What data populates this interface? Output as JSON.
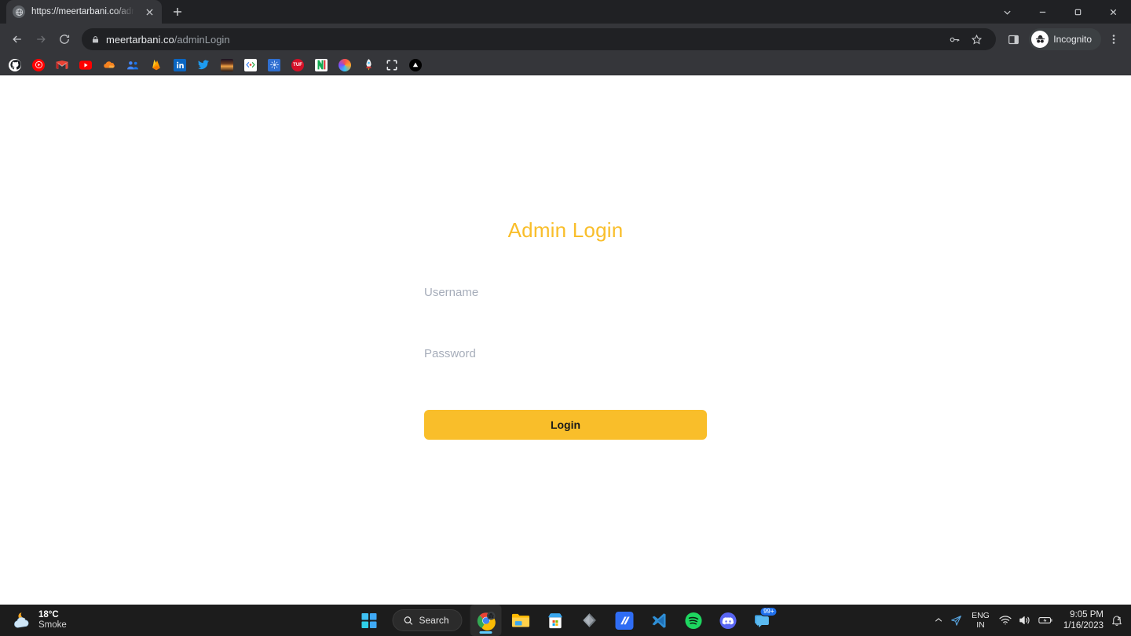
{
  "browser": {
    "tab": {
      "title": "https://meertarbani.co/adminLog",
      "favicon_name": "globe-icon",
      "close_label": "✕",
      "newtab_label": "+"
    },
    "window_controls": {
      "tab_search": "tab-search-chevron",
      "minimize": "–",
      "maximize": "❐",
      "close": "✕"
    },
    "toolbar": {
      "back": "back-arrow",
      "forward": "forward-arrow",
      "reload": "reload-arrow",
      "lock": "lock-icon",
      "url_domain": "meertarbani.co",
      "url_path": "/adminLogin",
      "password_key": "key-icon",
      "bookmark_star": "star-icon",
      "side_panel": "side-panel-icon",
      "incognito_label": "Incognito",
      "menu": "three-dot-menu"
    },
    "bookmarks": [
      {
        "name": "github",
        "short": "",
        "bg": "#ffffff",
        "fg": "#1b1f23"
      },
      {
        "name": "youtube-music",
        "short": "",
        "bg": "#ff0000",
        "fg": "#ffffff"
      },
      {
        "name": "gmail",
        "short": "M",
        "bg": "#ffffff",
        "fg": "#ea4335"
      },
      {
        "name": "youtube",
        "short": "▶",
        "bg": "#ff0000",
        "fg": "#ffffff"
      },
      {
        "name": "cloudflare",
        "short": "",
        "bg": "#ffffff",
        "fg": "#f6821f"
      },
      {
        "name": "google-meet",
        "short": "",
        "bg": "#ffffff",
        "fg": "#4285f4"
      },
      {
        "name": "firebase",
        "short": "",
        "bg": "#ffffff",
        "fg": "#ffa000"
      },
      {
        "name": "linkedin",
        "short": "in",
        "bg": "#0a66c2",
        "fg": "#ffffff"
      },
      {
        "name": "twitter",
        "short": "",
        "bg": "#ffffff",
        "fg": "#1d9bf0"
      },
      {
        "name": "sunset-photo",
        "short": "",
        "bg": "#c2703a",
        "fg": "#ffd9a0"
      },
      {
        "name": "google-developers",
        "short": "<>",
        "bg": "#ffffff",
        "fg": "#4285f4"
      },
      {
        "name": "blue-app",
        "short": "",
        "bg": "#2f6fd0",
        "fg": "#d7e6ff"
      },
      {
        "name": "tuf",
        "short": "TUF",
        "bg": "#d31027",
        "fg": "#ffffff"
      },
      {
        "name": "mongodb",
        "short": "M",
        "bg": "#ffffff",
        "fg": "#13aa52"
      },
      {
        "name": "color-sphere",
        "short": "",
        "bg": "#ffffff",
        "fg": "#ff6b6b"
      },
      {
        "name": "rocket",
        "short": "",
        "bg": "#ffffff",
        "fg": "#e53935"
      },
      {
        "name": "scan-frame",
        "short": "",
        "bg": "#35363a",
        "fg": "#e8eaed"
      },
      {
        "name": "vercel",
        "short": "▲",
        "bg": "#000000",
        "fg": "#ffffff"
      }
    ]
  },
  "page": {
    "title": "Admin Login",
    "username": {
      "placeholder": "Username",
      "value": ""
    },
    "password": {
      "placeholder": "Password",
      "value": ""
    },
    "login_button": "Login",
    "accent_color": "#f9be2a",
    "background_color": "#ffffff"
  },
  "taskbar": {
    "weather": {
      "temperature": "18°C",
      "condition": "Smoke",
      "icon": "moon-cloud-icon"
    },
    "search": {
      "label": "Search",
      "icon": "search-icon"
    },
    "apps": [
      {
        "name": "start-button",
        "label": ""
      },
      {
        "name": "chrome-incognito",
        "label": ""
      },
      {
        "name": "file-explorer",
        "label": ""
      },
      {
        "name": "microsoft-store",
        "label": ""
      },
      {
        "name": "gem-app",
        "label": ""
      },
      {
        "name": "mongodb-compass",
        "label": ""
      },
      {
        "name": "vs-code",
        "label": ""
      },
      {
        "name": "spotify",
        "label": ""
      },
      {
        "name": "discord",
        "label": ""
      },
      {
        "name": "messaging-app",
        "label": "99+"
      }
    ],
    "tray": {
      "overflow": "chevron-up-icon",
      "telegram": "send-arrow-icon",
      "language_primary": "ENG",
      "language_secondary": "IN",
      "wifi": "wifi-icon",
      "volume": "volume-icon",
      "battery": "battery-charging-icon",
      "time": "9:05 PM",
      "date": "1/16/2023",
      "notifications": "notification-icon"
    }
  }
}
